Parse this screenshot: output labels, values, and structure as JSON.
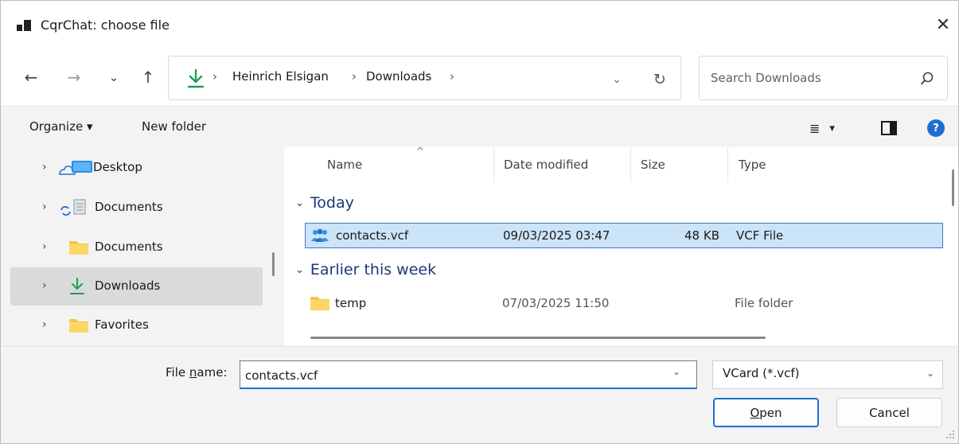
{
  "window": {
    "title": "CqrChat: choose file",
    "close_glyph": "✕"
  },
  "nav": {
    "back": "←",
    "forward": "→",
    "recent": "⌄",
    "up": "↑"
  },
  "address": {
    "breadcrumbs": [
      "Heinrich Elsigan",
      "Downloads"
    ],
    "separator": "›",
    "dropdown_glyph": "⌄",
    "refresh_glyph": "↻"
  },
  "search": {
    "placeholder": "Search Downloads"
  },
  "toolbar": {
    "organize": "Organize ▾",
    "new_folder": "New folder",
    "view_glyph": "≣",
    "view_dropdown": "▾",
    "help": "?"
  },
  "sidebar": {
    "items": [
      {
        "label": "Desktop",
        "icon": "onedrive-desktop-icon"
      },
      {
        "label": "Documents",
        "icon": "sync-documents-icon"
      },
      {
        "label": "Documents",
        "icon": "folder-icon"
      },
      {
        "label": "Downloads",
        "icon": "download-icon",
        "selected": true
      },
      {
        "label": "Favorites",
        "icon": "folder-icon"
      }
    ],
    "chevron": "›"
  },
  "columns": {
    "name": "Name",
    "date": "Date modified",
    "size": "Size",
    "type": "Type",
    "sort_glyph": "^"
  },
  "groups": [
    {
      "label": "Today",
      "files": [
        {
          "name": "contacts.vcf",
          "date": "09/03/2025 03:47",
          "size": "48 KB",
          "type": "VCF File",
          "icon": "contacts-file-icon",
          "selected": true
        }
      ]
    },
    {
      "label": "Earlier this week",
      "files": [
        {
          "name": "temp",
          "date": "07/03/2025 11:50",
          "size": "",
          "type": "File folder",
          "icon": "folder-icon",
          "selected": false
        }
      ]
    }
  ],
  "group_chevron": "⌄",
  "bottom": {
    "filename_label_prefix": "File ",
    "filename_label_underlined": "n",
    "filename_label_suffix": "ame:",
    "filename_value": "contacts.vcf",
    "filetype_value": "VCard (*.vcf)",
    "dropdown_glyph": "⌄",
    "open_underlined": "O",
    "open_rest": "pen",
    "cancel": "Cancel"
  },
  "colors": {
    "accent": "#1f6fd1",
    "selection": "#cce4f7",
    "group_heading": "#1a3a7a",
    "folder": "#f5c64a",
    "download": "#1e9e5a"
  }
}
